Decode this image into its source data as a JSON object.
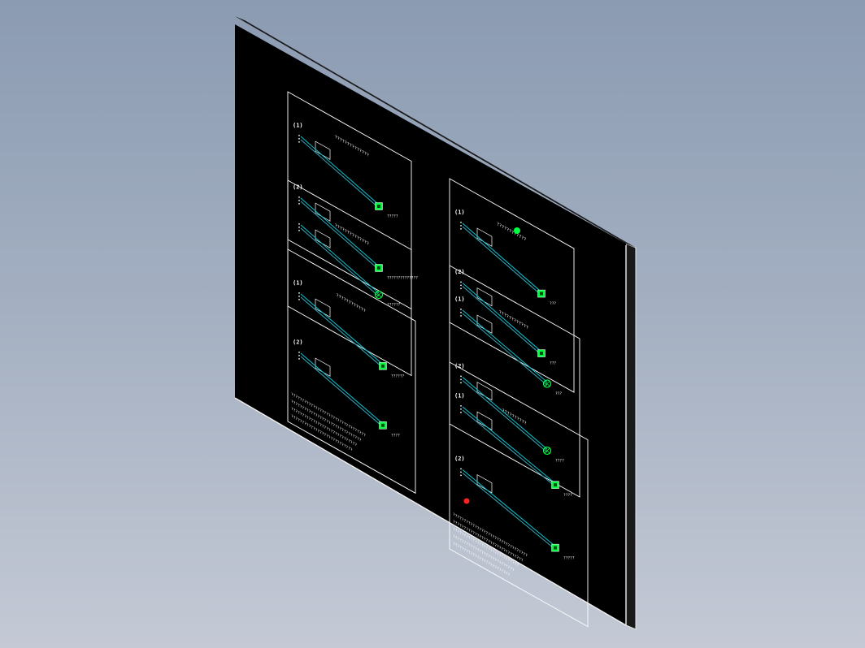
{
  "scene": {
    "kind": "isometric-cad-view",
    "background": {
      "top": "#8b9bb2",
      "bottom": "#c4c9d5"
    },
    "board_color": "#000000",
    "edge_color": "#f2f2f2"
  },
  "colors": {
    "frame": "#ffffff",
    "wire": "#00c8d8",
    "wire_dim": "#3aa9b8",
    "lamp": "#00ff40",
    "marker_green": "#00ff40",
    "marker_red": "#ff2020"
  },
  "panels": [
    {
      "id": "p1",
      "row_labels": [
        "(1)",
        "(2)"
      ],
      "caption": "??????????????",
      "lamp_type": "square",
      "footer_lines": 0,
      "lamp_labels": [
        "?????",
        "??????????????"
      ]
    },
    {
      "id": "p2",
      "row_labels": [],
      "caption": "??????????????",
      "lamp_type": "circle",
      "footer_lines": 0,
      "lamp_labels": [
        "??????"
      ]
    },
    {
      "id": "p3",
      "row_labels": [
        "(1)",
        "(2)"
      ],
      "caption": "????????????",
      "lamp_type": "square",
      "footer_lines": 4,
      "lamp_labels": [
        "??????",
        "????"
      ]
    },
    {
      "id": "p4",
      "row_labels": [
        "(1)",
        "(2)"
      ],
      "caption": "????????????",
      "lamp_type": "square",
      "footer_lines": 0,
      "lamp_labels": [
        "???",
        "???"
      ]
    },
    {
      "id": "p5",
      "row_labels": [
        "(1)",
        "(2)"
      ],
      "caption": "????????????",
      "lamp_type": "circle",
      "footer_lines": 0,
      "lamp_labels": [
        "???",
        "????"
      ]
    },
    {
      "id": "p6",
      "row_labels": [
        "(1)",
        "(2)"
      ],
      "caption": "??????????",
      "lamp_type": "square",
      "footer_lines": 5,
      "lamp_labels": [
        "????",
        "?????"
      ]
    }
  ]
}
